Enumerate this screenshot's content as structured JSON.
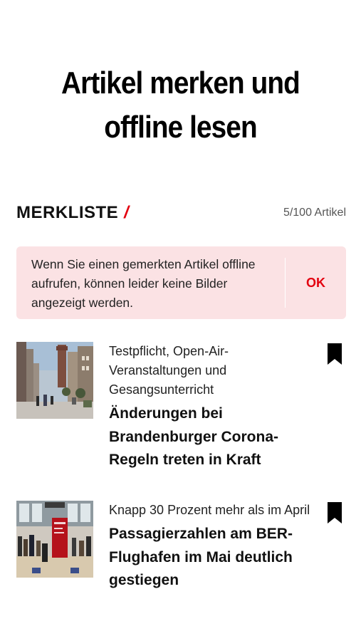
{
  "hero": {
    "line1": "Artikel merken und",
    "line2": "offline lesen"
  },
  "watchlist": {
    "title": "MERKLISTE",
    "slash": "/",
    "count": "5/100 Artikel"
  },
  "notice": {
    "text": "Wenn Sie einen gemerkten Artikel offline aufrufen, können leider keine Bilder angezeigt werden.",
    "ok_label": "OK"
  },
  "articles": [
    {
      "kicker": "Testpflicht, Open-Air-Veranstaltungen und Gesangsunterricht",
      "headline": "Änderungen bei Brandenburger Corona-Regeln treten in Kraft",
      "bookmark_icon": "bookmark-filled-icon",
      "thumbnail": "street-scene-photo"
    },
    {
      "kicker": "Knapp 30 Prozent mehr als im April",
      "headline": "Passagierzahlen am BER-Flughafen im Mai deutlich gestiegen",
      "bookmark_icon": "bookmark-filled-icon",
      "thumbnail": "airport-terminal-photo"
    }
  ],
  "colors": {
    "accent": "#e3000f",
    "notice_bg": "#fbe2e4"
  }
}
